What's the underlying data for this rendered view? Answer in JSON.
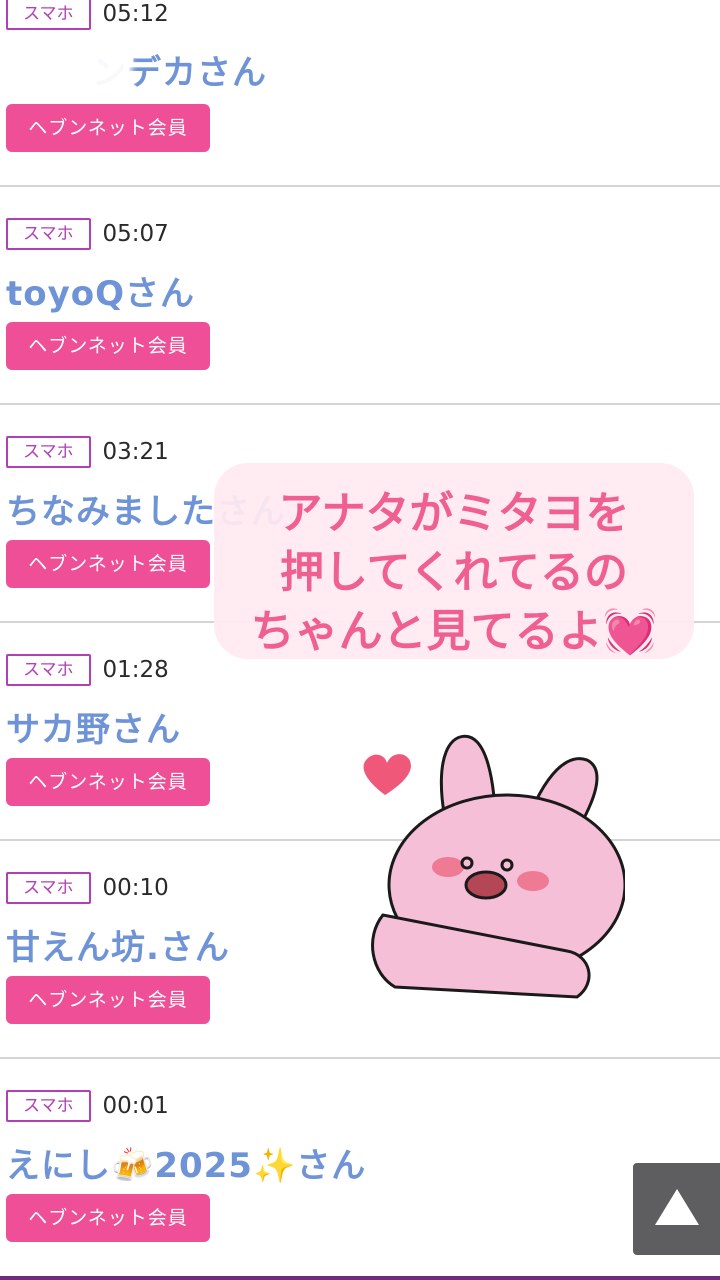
{
  "entries": [
    {
      "device": "スマホ",
      "time": "05:12",
      "name": "ンデカさん",
      "member_button": "ヘブンネット会員"
    },
    {
      "device": "スマホ",
      "time": "05:07",
      "name": "toyoQさん",
      "member_button": "ヘブンネット会員"
    },
    {
      "device": "スマホ",
      "time": "03:21",
      "name": "ちなみましたさん",
      "member_button": "ヘブンネット会員"
    },
    {
      "device": "スマホ",
      "time": "01:28",
      "name": "サカ野さん",
      "member_button": "ヘブンネット会員"
    },
    {
      "device": "スマホ",
      "time": "00:10",
      "name": "甘えん坊.さん",
      "member_button": "ヘブンネット会員"
    },
    {
      "device": "スマホ",
      "time": "00:01",
      "name": "えにし🍻2025✨さん",
      "member_button": "ヘブンネット会員"
    }
  ],
  "overlay": {
    "line1": "アナタがミタヨを",
    "line2": "押してくれてるの",
    "line3": "ちゃんと見てるよ",
    "heart": "💓"
  },
  "scroll_top": {
    "icon": "triangle-up-icon"
  },
  "colors": {
    "badge": "#b23fb7",
    "name": "#6e93d6",
    "member_button": "#ee4f97",
    "caption_text": "#ef5f8f",
    "caption_bg": "#ffeaf0",
    "scroll_top_bg": "#5e5e60"
  }
}
